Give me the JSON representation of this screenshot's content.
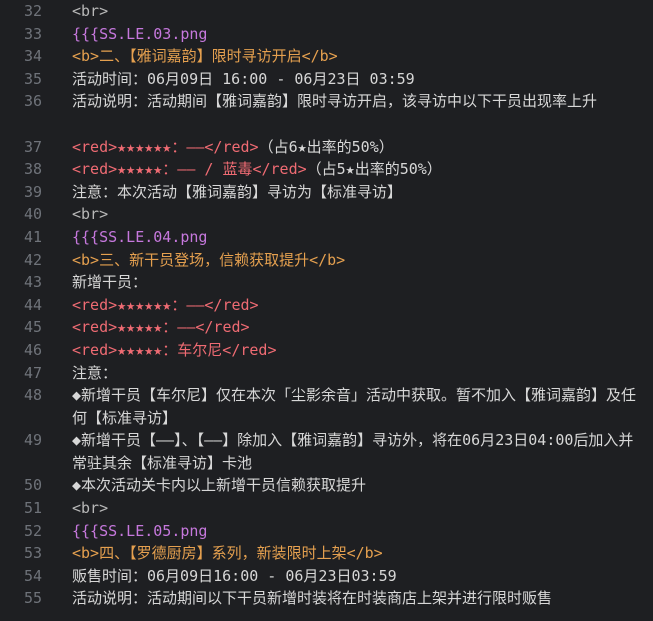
{
  "editor": {
    "lines": [
      {
        "number": "32",
        "parts": [
          {
            "text": "<br>",
            "class": "c-gray"
          }
        ]
      },
      {
        "number": "33",
        "parts": [
          {
            "text": "{{{SS.LE.03.png",
            "class": "c-purple"
          }
        ]
      },
      {
        "number": "34",
        "parts": [
          {
            "text": "<b>二、【雅词嘉韵】限时寻访开启</b>",
            "class": "c-orange"
          }
        ]
      },
      {
        "number": "35",
        "parts": [
          {
            "text": "活动时间：06月09日 16:00 - 06月23日 03:59",
            "class": "c-white"
          }
        ]
      },
      {
        "number": "36",
        "wrap": true,
        "parts": [
          {
            "text": "活动说明：活动期间【雅词嘉韵】限时寻访开启，该寻访中以下干员出现率上升",
            "class": "c-white"
          }
        ]
      },
      {
        "number": "37",
        "parts": [
          {
            "text": "<red>★★★★★★：——</red>",
            "class": "c-red"
          },
          {
            "text": "（占6★出率的50%）",
            "class": "c-white"
          }
        ]
      },
      {
        "number": "38",
        "parts": [
          {
            "text": "<red>★★★★★：—— / 蓝毒</red>",
            "class": "c-red"
          },
          {
            "text": "（占5★出率的50%）",
            "class": "c-white"
          }
        ]
      },
      {
        "number": "39",
        "parts": [
          {
            "text": "注意：本次活动【雅词嘉韵】寻访为【标准寻访】",
            "class": "c-white"
          }
        ]
      },
      {
        "number": "40",
        "parts": [
          {
            "text": "<br>",
            "class": "c-gray"
          }
        ]
      },
      {
        "number": "41",
        "parts": [
          {
            "text": "{{{SS.LE.04.png",
            "class": "c-purple"
          }
        ]
      },
      {
        "number": "42",
        "parts": [
          {
            "text": "<b>三、新干员登场，信赖获取提升</b>",
            "class": "c-orange"
          }
        ]
      },
      {
        "number": "43",
        "parts": [
          {
            "text": "新增干员：",
            "class": "c-white"
          }
        ]
      },
      {
        "number": "44",
        "parts": [
          {
            "text": "<red>★★★★★★：——</red>",
            "class": "c-red"
          }
        ]
      },
      {
        "number": "45",
        "parts": [
          {
            "text": "<red>★★★★★：——</red>",
            "class": "c-red"
          }
        ]
      },
      {
        "number": "46",
        "parts": [
          {
            "text": "<red>★★★★★：车尔尼</red>",
            "class": "c-red"
          }
        ]
      },
      {
        "number": "47",
        "parts": [
          {
            "text": "注意：",
            "class": "c-white"
          }
        ]
      },
      {
        "number": "48",
        "wrap": true,
        "parts": [
          {
            "text": "◆新增干员【车尔尼】仅在本次「尘影余音」活动中获取。暂不加入【雅词嘉韵】及任何【标准寻访】",
            "class": "c-white"
          }
        ]
      },
      {
        "number": "49",
        "wrap": true,
        "parts": [
          {
            "text": "◆新增干员【——】、【——】除加入【雅词嘉韵】寻访外，将在06月23日04:00后加入并常驻其余【标准寻访】卡池",
            "class": "c-white"
          }
        ]
      },
      {
        "number": "50",
        "parts": [
          {
            "text": "◆本次活动关卡内以上新增干员信赖获取提升",
            "class": "c-white"
          }
        ]
      },
      {
        "number": "51",
        "parts": [
          {
            "text": "<br>",
            "class": "c-gray"
          }
        ]
      },
      {
        "number": "52",
        "parts": [
          {
            "text": "{{{SS.LE.05.png",
            "class": "c-purple"
          }
        ]
      },
      {
        "number": "53",
        "parts": [
          {
            "text": "<b>四、【罗德厨房】系列，新装限时上架</b>",
            "class": "c-orange"
          }
        ]
      },
      {
        "number": "54",
        "parts": [
          {
            "text": "贩售时间：06月09日16:00 - 06月23日03:59",
            "class": "c-white"
          }
        ]
      },
      {
        "number": "55",
        "parts": [
          {
            "text": "活动说明：活动期间以下干员新增时装将在时装商店上架并进行限时贩售",
            "class": "c-white"
          }
        ]
      }
    ]
  },
  "colors": {
    "background": "#1e1f22",
    "gutter": "#6f737a",
    "text": "#d7d7d7",
    "purple": "#c678dd",
    "orange": "#e5a04f",
    "red": "#ef6b73"
  }
}
